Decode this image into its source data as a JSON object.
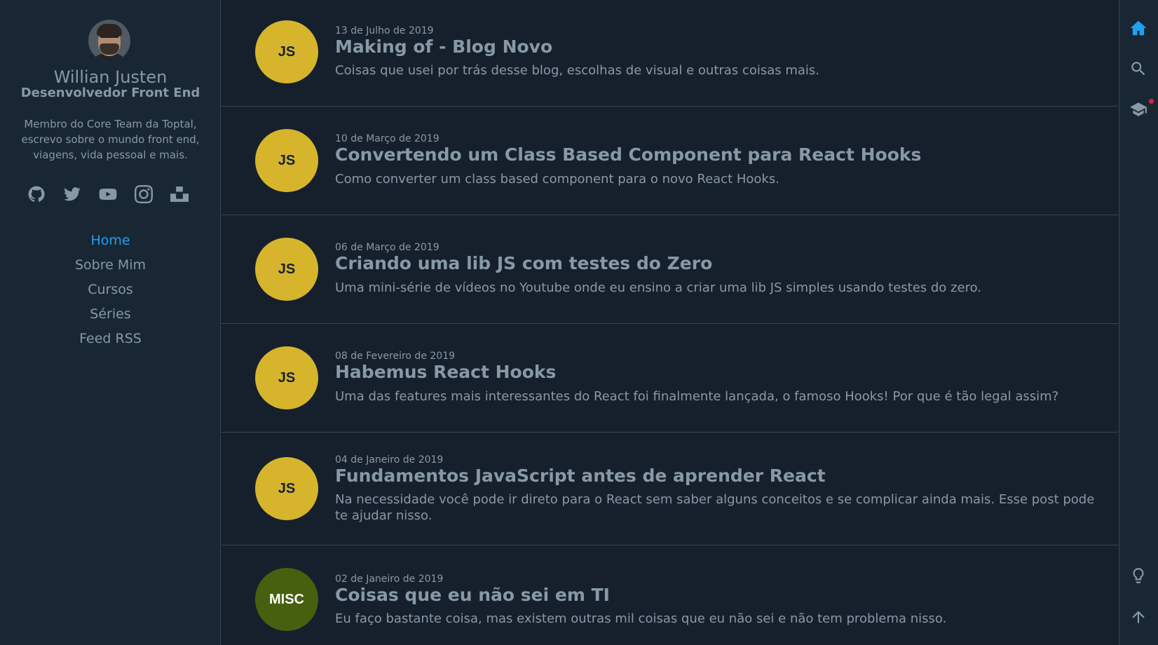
{
  "profile": {
    "name": "Willian Justen",
    "role": "Desenvolvedor Front End",
    "description": "Membro do Core Team da Toptal, escrevo sobre o mundo front end, viagens, vida pessoal e mais."
  },
  "social": [
    "github-icon",
    "twitter-icon",
    "youtube-icon",
    "instagram-icon",
    "unsplash-icon"
  ],
  "menu": {
    "items": [
      {
        "label": "Home",
        "active": true
      },
      {
        "label": "Sobre Mim"
      },
      {
        "label": "Cursos"
      },
      {
        "label": "Séries"
      },
      {
        "label": "Feed RSS"
      }
    ]
  },
  "posts": [
    {
      "tag": "JS",
      "tag_color": "#d6b52c",
      "tag_text_color": "#16202c",
      "date": "13 de Julho de 2019",
      "title": "Making of - Blog Novo",
      "description": "Coisas que usei por trás desse blog, escolhas de visual e outras coisas mais."
    },
    {
      "tag": "JS",
      "tag_color": "#d6b52c",
      "tag_text_color": "#16202c",
      "date": "10 de Março de 2019",
      "title": "Convertendo um Class Based Component para React Hooks",
      "description": "Como converter um class based component para o novo React Hooks."
    },
    {
      "tag": "JS",
      "tag_color": "#d6b52c",
      "tag_text_color": "#16202c",
      "date": "06 de Março de 2019",
      "title": "Criando uma lib JS com testes do Zero",
      "description": "Uma mini-série de vídeos no Youtube onde eu ensino a criar uma lib JS simples usando testes do zero."
    },
    {
      "tag": "JS",
      "tag_color": "#d6b52c",
      "tag_text_color": "#16202c",
      "date": "08 de Fevereiro de 2019",
      "title": "Habemus React Hooks",
      "description": "Uma das features mais interessantes do React foi finalmente lançada, o famoso Hooks! Por que é tão legal assim?"
    },
    {
      "tag": "JS",
      "tag_color": "#d6b52c",
      "tag_text_color": "#16202c",
      "date": "04 de Janeiro de 2019",
      "title": "Fundamentos JavaScript antes de aprender React",
      "description": "Na necessidade você pode ir direto para o React sem saber alguns conceitos e se complicar ainda mais. Esse post pode te ajudar nisso."
    },
    {
      "tag": "MISC",
      "tag_color": "#46600f",
      "tag_text_color": "#ffffff",
      "date": "02 de Janeiro de 2019",
      "title": "Coisas que eu não sei em TI",
      "description": "Eu faço bastante coisa, mas existem outras mil coisas que eu não sei e não tem problema nisso."
    }
  ],
  "toolbar": {
    "top": [
      "home-icon",
      "search-icon",
      "graduation-cap-icon"
    ],
    "bottom": [
      "lightbulb-icon",
      "arrow-up-icon"
    ],
    "active_color": "#1fa1f2"
  }
}
